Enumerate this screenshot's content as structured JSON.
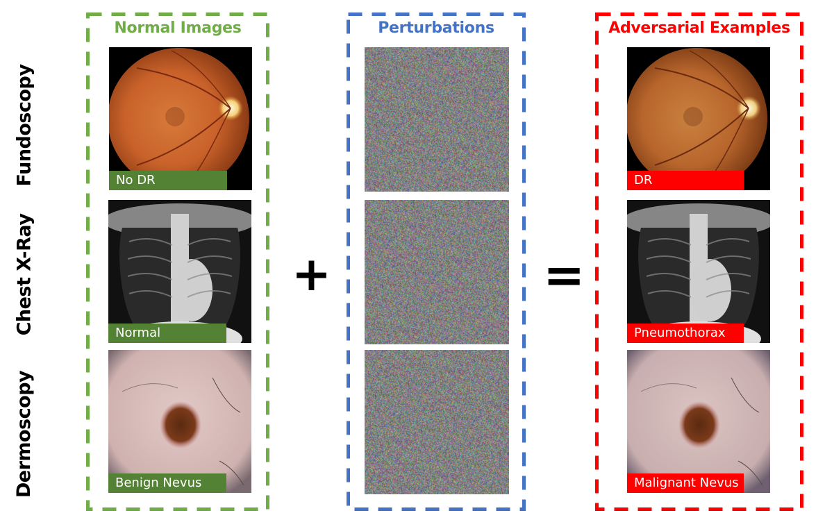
{
  "figure": {
    "rows": [
      {
        "label": "Fundoscopy",
        "icon": "retina-fundus-image"
      },
      {
        "label": "Chest X-Ray",
        "icon": "chest-xray-image"
      },
      {
        "label": "Dermoscopy",
        "icon": "skin-lesion-image"
      }
    ],
    "operators": {
      "plus": "+",
      "equals": "="
    },
    "panels": {
      "normal": {
        "title": "Normal Images",
        "color": "#70ad47",
        "tag_color": "#548235",
        "tags": [
          "No DR",
          "Normal",
          "Benign Nevus"
        ]
      },
      "perturbations": {
        "title": "Perturbations",
        "color": "#4472c4"
      },
      "adversarial": {
        "title": "Adversarial Examples",
        "color": "#ff0000",
        "tag_color": "#ff0000",
        "tags": [
          "DR",
          "Pneumothorax",
          "Malignant Nevus"
        ]
      }
    }
  }
}
